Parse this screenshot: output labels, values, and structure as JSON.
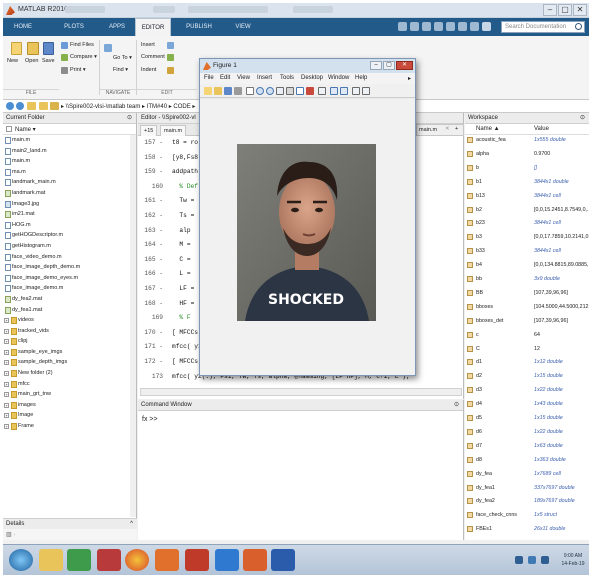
{
  "app": {
    "title": "MATLAB R2016a",
    "window_controls": [
      "–",
      "▢",
      "✕"
    ]
  },
  "ribbon_tabs": [
    "HOME",
    "PLOTS",
    "APPS",
    "EDITOR",
    "PUBLISH",
    "VIEW"
  ],
  "search": {
    "placeholder": "Search Documentation"
  },
  "ribbon": {
    "new": "New",
    "open": "Open",
    "save": "Save",
    "find_files": "Find Files",
    "compare": "Compare ▾",
    "print": "Print ▾",
    "insert": "Insert",
    "comment": "Comment",
    "indent": "Indent",
    "goto": "Go To ▾",
    "find": "Find ▾",
    "sections": [
      "FILE",
      "NAVIGATE",
      "EDIT"
    ]
  },
  "address": {
    "path": "▸ \\\\Spire002-vlsi-\\matlab team ▸ ITM#40 ▸ CODE ▸"
  },
  "current_folder": {
    "title": "Current Folder",
    "column": "Name ▾",
    "files": [
      {
        "name": "main.m",
        "type": "m"
      },
      {
        "name": "main2_land.m",
        "type": "m"
      },
      {
        "name": "main.m",
        "type": "m"
      },
      {
        "name": "ma.m",
        "type": "m"
      },
      {
        "name": "landmark_main.m",
        "type": "m"
      },
      {
        "name": "landmark.mat",
        "type": "mat"
      },
      {
        "name": "Image3.jpg",
        "type": "jpg"
      },
      {
        "name": "im21.mat",
        "type": "mat"
      },
      {
        "name": "HOG.m",
        "type": "m"
      },
      {
        "name": "getHOGDescriptor.m",
        "type": "m"
      },
      {
        "name": "getHistogram.m",
        "type": "m"
      },
      {
        "name": "face_video_demo.m",
        "type": "m"
      },
      {
        "name": "face_image_depth_demo.m",
        "type": "m"
      },
      {
        "name": "face_image_demo_eyes.m",
        "type": "m"
      },
      {
        "name": "face_image_demo.m",
        "type": "m"
      },
      {
        "name": "dy_fea2.mat",
        "type": "mat"
      },
      {
        "name": "dy_fea1.mat",
        "type": "mat"
      }
    ],
    "folders": [
      "videos",
      "tracked_vids",
      "clipj",
      "sample_eye_imgs",
      "sample_depth_imgs",
      "New folder (2)",
      "mfcc",
      "main_grt_tnw",
      "images",
      "Image",
      "Frame"
    ],
    "details": "Details"
  },
  "editor": {
    "title": "Editor - \\\\Spire002-vl",
    "tabs": [
      "+15",
      "main.m"
    ],
    "side_tab": "main.m",
    "lines": [
      {
        "n": "157 -",
        "text": "t8 = ro"
      },
      {
        "n": "158 -",
        "text": "[y8,Fs8"
      },
      {
        "n": "159 -",
        "text": "addpath"
      },
      {
        "n": "160",
        "text": "  % Def",
        "comment": true
      },
      {
        "n": "161 -",
        "text": "  Tw ="
      },
      {
        "n": "162 -",
        "text": "  Ts ="
      },
      {
        "n": "163 -",
        "text": "  alp"
      },
      {
        "n": "164 -",
        "text": "  M ="
      },
      {
        "n": "165 -",
        "text": "  C ="
      },
      {
        "n": "166 -",
        "text": "  L ="
      },
      {
        "n": "167 -",
        "text": "  LF ="
      },
      {
        "n": "168 -",
        "text": "  HF ="
      },
      {
        "n": "169",
        "text": "  % F",
        "comment": true
      },
      {
        "n": "170 -",
        "text": "[ MFCCs"
      },
      {
        "n": "171 -",
        "text": "mfcc( y1"
      },
      {
        "n": "172 -",
        "text": "[ MFCCs, FBEs, frames ] = ..."
      },
      {
        "n": "173",
        "text": "mfcc( y2(:), Fs1, Tw, Ts, alpha, @hamming, [LF HF], M, C+1, L );"
      }
    ]
  },
  "command_window": {
    "title": "Command Window",
    "prompt": "fx >>"
  },
  "figure": {
    "title": "Figure 1",
    "menu": [
      "File",
      "Edit",
      "View",
      "Insert",
      "Tools",
      "Desktop",
      "Window",
      "Help"
    ],
    "image_caption": "SHOCKED"
  },
  "workspace": {
    "title": "Workspace",
    "columns": [
      "Name ▲",
      "Value"
    ],
    "rows": [
      {
        "name": "acoustic_fea",
        "value": "1x555 double",
        "light": true
      },
      {
        "name": "alpha",
        "value": "0.9700"
      },
      {
        "name": "b",
        "value": "[]",
        "light": true
      },
      {
        "name": "b1",
        "value": "3844x1 double",
        "light": true
      },
      {
        "name": "b13",
        "value": "3844x1 cell",
        "light": true
      },
      {
        "name": "b2",
        "value": "[0,0,15.2451,8.7549,0,..."
      },
      {
        "name": "b23",
        "value": "3844x1 cell",
        "light": true
      },
      {
        "name": "b3",
        "value": "[0,0,17.7859,10.2141,0,..."
      },
      {
        "name": "b33",
        "value": "3844x1 cell",
        "light": true
      },
      {
        "name": "b4",
        "value": "[0,0,134.8815,89.0885,..."
      },
      {
        "name": "bb",
        "value": "3x9 double",
        "light": true
      },
      {
        "name": "BB",
        "value": "[107,39,96,96]"
      },
      {
        "name": "bboxes",
        "value": "[104.5000,44.5000,212..."
      },
      {
        "name": "bboxes_det",
        "value": "[107,39,96,96]"
      },
      {
        "name": "c",
        "value": "64"
      },
      {
        "name": "C",
        "value": "12"
      },
      {
        "name": "d1",
        "value": "1x12 double",
        "light": true
      },
      {
        "name": "d2",
        "value": "1x15 double",
        "light": true
      },
      {
        "name": "d3",
        "value": "1x22 double",
        "light": true
      },
      {
        "name": "d4",
        "value": "1x43 double",
        "light": true
      },
      {
        "name": "d5",
        "value": "1x15 double",
        "light": true
      },
      {
        "name": "d6",
        "value": "1x22 double",
        "light": true
      },
      {
        "name": "d7",
        "value": "1x63 double",
        "light": true
      },
      {
        "name": "d8",
        "value": "1x363 double",
        "light": true
      },
      {
        "name": "dy_fea",
        "value": "1x7689 cell",
        "light": true
      },
      {
        "name": "dy_fea1",
        "value": "337x7697 double",
        "light": true
      },
      {
        "name": "dy_fea2",
        "value": "189x7697 double",
        "light": true
      },
      {
        "name": "face_check_cnns",
        "value": "1x5 struct",
        "light": true
      },
      {
        "name": "FBEs1",
        "value": "26x11 double",
        "light": true
      }
    ]
  },
  "taskbar": {
    "time": "9:00 AM",
    "date": "14-Feb-19"
  },
  "colors": {
    "ribbon_tab_bg": "#225a8a",
    "accent": "#3b5fb0",
    "comment_green": "#228b22"
  }
}
